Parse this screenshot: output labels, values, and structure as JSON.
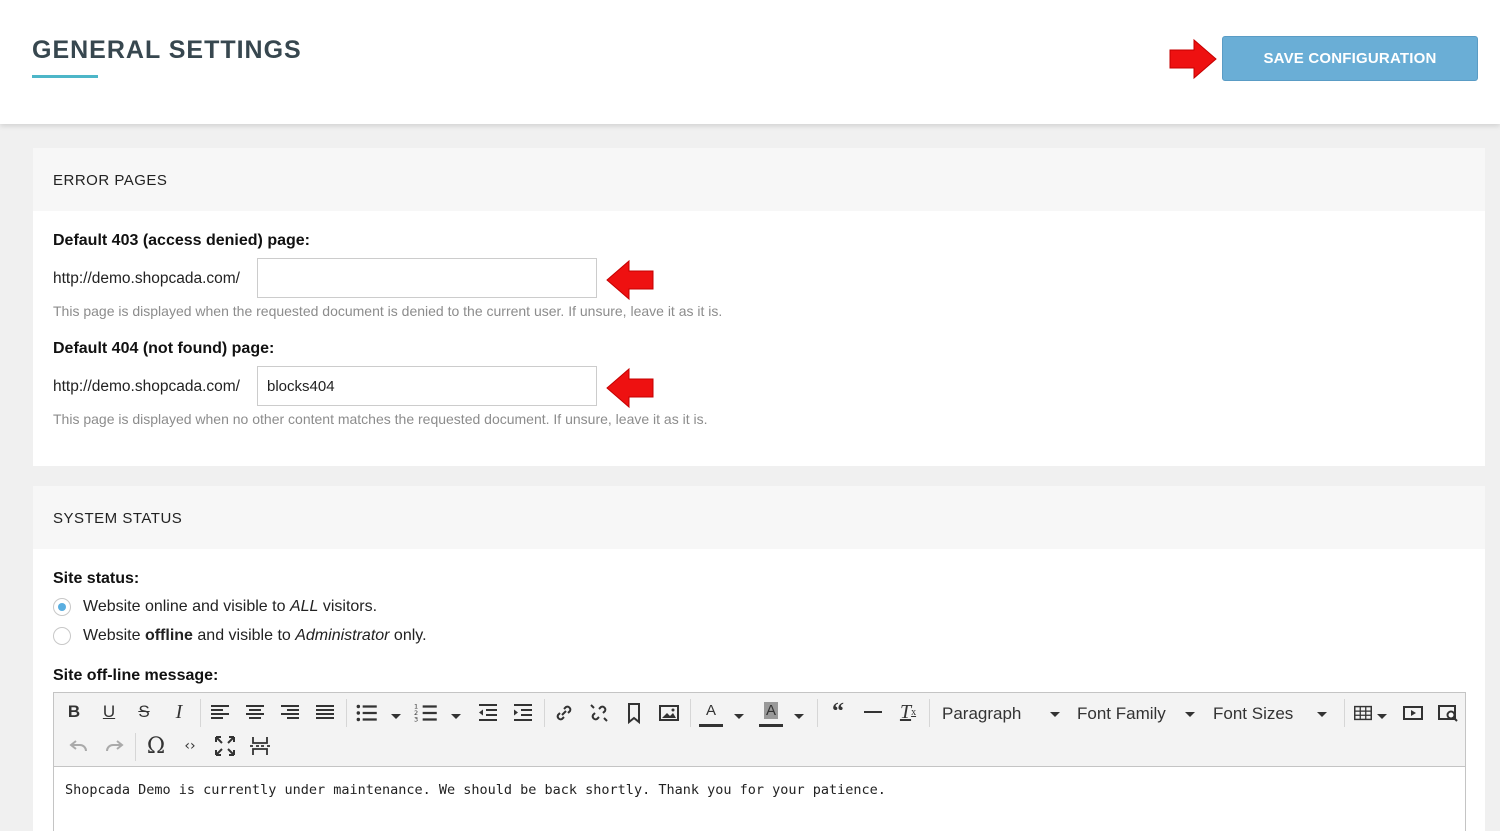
{
  "header": {
    "title": "GENERAL SETTINGS",
    "save_label": "SAVE CONFIGURATION"
  },
  "error_pages": {
    "heading": "ERROR PAGES",
    "page_403": {
      "label": "Default 403 (access denied) page:",
      "prefix": "http://demo.shopcada.com/",
      "value": "",
      "help": "This page is displayed when the requested document is denied to the current user. If unsure, leave it as it is."
    },
    "page_404": {
      "label": "Default 404 (not found) page:",
      "prefix": "http://demo.shopcada.com/",
      "value": "blocks404",
      "help": "This page is displayed when no other content matches the requested document. If unsure, leave it as it is."
    }
  },
  "system_status": {
    "heading": "SYSTEM STATUS",
    "site_status_label": "Site status:",
    "options": [
      {
        "pre": "Website online and visible to ",
        "em": "ALL",
        "post": " visitors.",
        "selected": true
      },
      {
        "pre": "Website ",
        "strong": "offline",
        "mid": " and visible to ",
        "em": "Administrator",
        "post": " only.",
        "selected": false
      }
    ],
    "offline_message_label": "Site off-line message:",
    "editor": {
      "format_dropdown": "Paragraph",
      "font_family_dropdown": "Font Family",
      "font_size_dropdown": "Font Sizes",
      "content": "Shopcada Demo is currently under maintenance. We should be back shortly. Thank you for your patience."
    }
  },
  "colors": {
    "accent_underline": "#4db6c8",
    "save_button": "#6aaed6",
    "annotation_arrow": "#ee1111",
    "radio_selected": "#5aaee0"
  }
}
